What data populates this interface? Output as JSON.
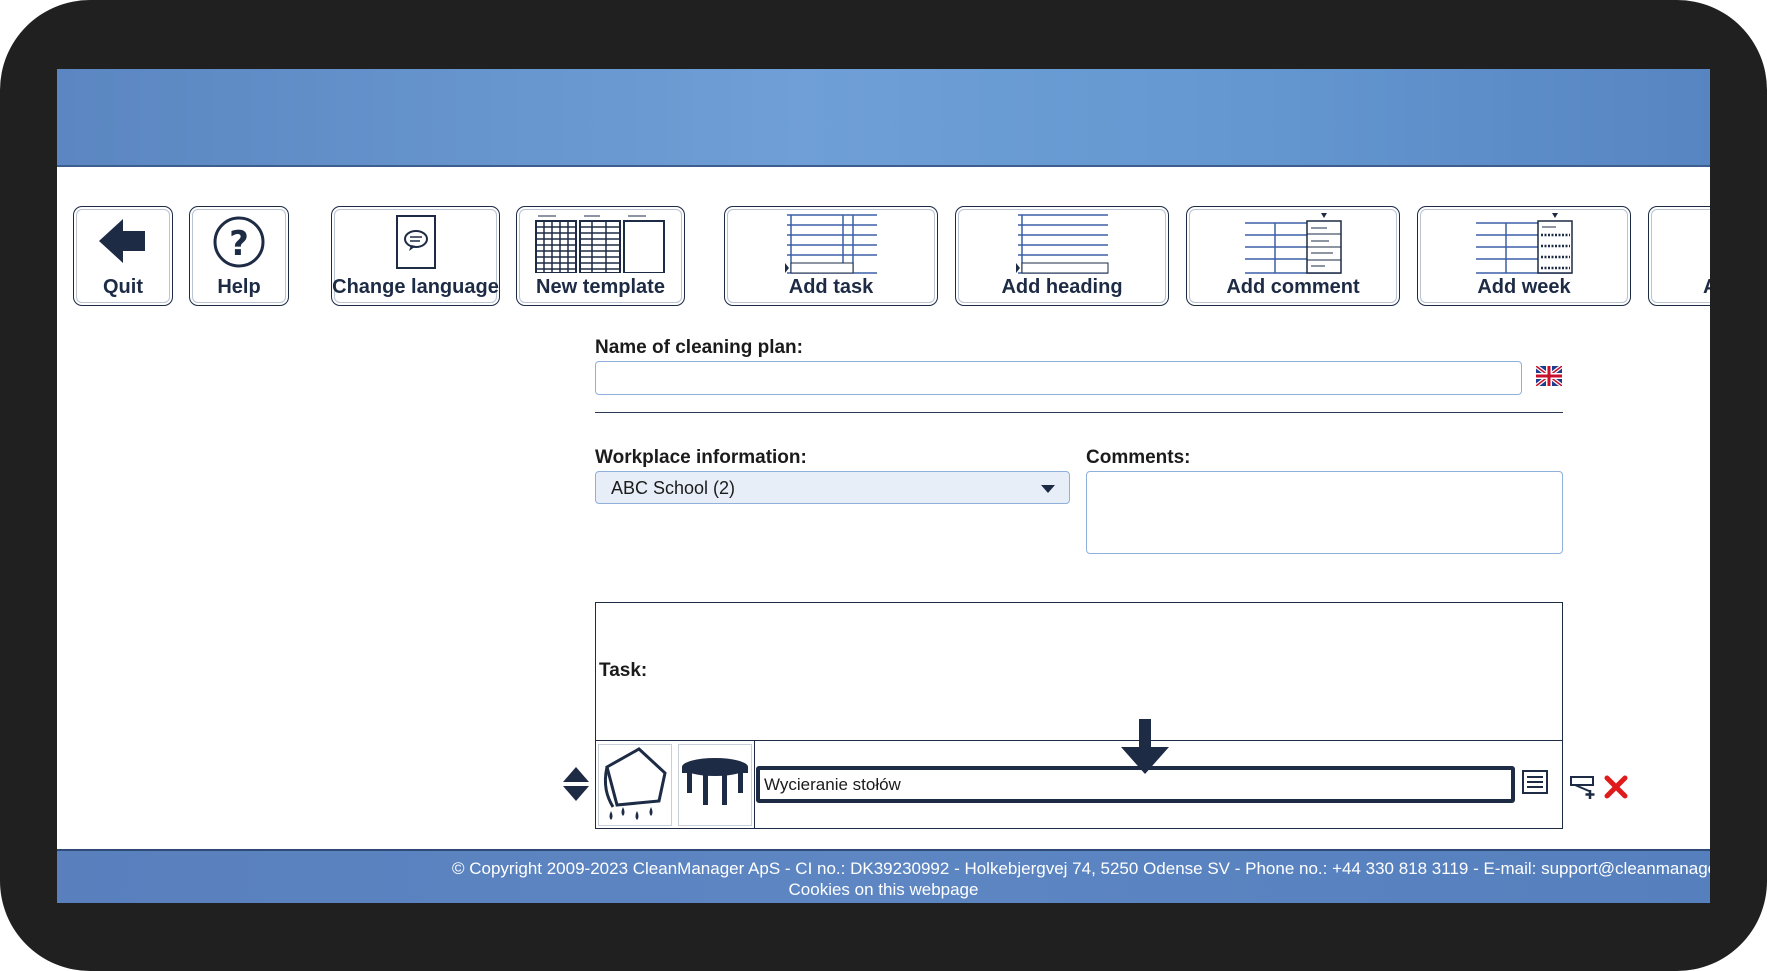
{
  "toolbar": {
    "quit": "Quit",
    "help": "Help",
    "change_language": "Change language",
    "new_template": "New template",
    "add_task": "Add task",
    "add_heading": "Add heading",
    "add_comment": "Add comment",
    "add_week": "Add week",
    "partial": "A"
  },
  "form": {
    "name_label": "Name of cleaning plan:",
    "name_value": "",
    "workplace_label": "Workplace information:",
    "workplace_value": "ABC School (2)",
    "comments_label": "Comments:",
    "comments_value": "",
    "task_label": "Task:",
    "task_value": "Wycieranie stołów"
  },
  "icons": {
    "flag": "uk-flag-icon",
    "move": "move-up-down-icon",
    "cloth": "wet-cloth-icon",
    "table": "table-icon",
    "details": "details-list-icon",
    "add_row": "add-row-icon",
    "delete": "delete-x-icon",
    "pointer": "down-arrow-pointer-icon"
  },
  "colors": {
    "accent": "#1d2b45",
    "band": "#6a9ad4",
    "delete": "#e01b1b"
  },
  "footer": {
    "copyright": "© Copyright 2009-2023 CleanManager ApS - CI no.: DK39230992 - Holkebjergvej 74, 5250 Odense SV - Phone no.: +44 330 818 3119 - E-mail: support@cleanmanager.",
    "cookies": "Cookies on this webpage"
  }
}
